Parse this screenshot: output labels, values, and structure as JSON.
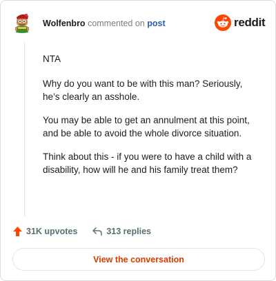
{
  "comment": {
    "username": "Wolfenbro",
    "verb": "commented on",
    "target": "post",
    "avatar_icon": "snoo-avatar-icon",
    "paragraphs": [
      "NTA",
      "Why do you want to be with this man? Seriously, he’s clearly an asshole.",
      "You may be able to get an annulment at this point, and be able to avoid the whole divorce situation.",
      "Think about this - if you were to have a child with a disability, how will he and his family treat them?"
    ]
  },
  "brand": {
    "wordmark": "reddit",
    "icon": "reddit-logo-icon",
    "color": "#ff4500"
  },
  "actions": {
    "upvotes": "31K upvotes",
    "upvote_icon": "upvote-arrow-icon",
    "upvote_color": "#ff4500",
    "replies": "313 replies",
    "reply_icon": "reply-arrow-icon"
  },
  "cta": {
    "label": "View the conversation",
    "color": "#d93a00"
  }
}
